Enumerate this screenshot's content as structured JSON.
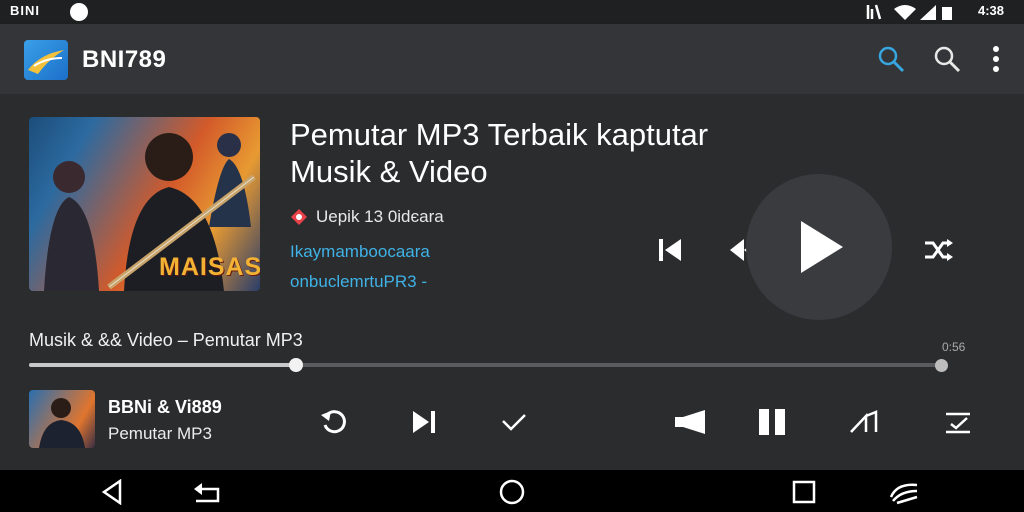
{
  "status_bar": {
    "carrier": "BINI",
    "time": "4:38"
  },
  "app_bar": {
    "title": "BNI789"
  },
  "now_playing": {
    "title": "Pemutar MP3 Terbaik kaptutar Musik & Video",
    "source_text": "Uepik 13 0idєara",
    "link_line_1": "Ikaymamboocaara",
    "link_line_2": "onbuclemrtuPR3 -",
    "art_caption": "MAISAS",
    "track_label": "Musik & && Video – Pemutar MP3",
    "total_time": "0:56",
    "progress": 0.293
  },
  "mini_player": {
    "title": "BBNi & Vi889",
    "subtitle": "Pemutar MP3"
  },
  "colors": {
    "accent": "#3fb2e6",
    "source_icon": "#e8414a",
    "background": "#2b2c2e",
    "app_bar": "#343538"
  },
  "icons": {
    "app_bar": [
      "search-icon",
      "search-icon",
      "more-vertical-icon"
    ],
    "player_controls": [
      "skip-previous-icon",
      "rewind-icon",
      "play-icon",
      "shuffle-icon"
    ],
    "mini_controls": [
      "replay-icon",
      "skip-next-icon",
      "check-icon",
      "volume-icon",
      "pause-icon",
      "trend-icon",
      "equalizer-icon"
    ],
    "nav": [
      "back-icon",
      "undo-icon",
      "home-icon",
      "recents-icon",
      "cast-icon"
    ]
  }
}
